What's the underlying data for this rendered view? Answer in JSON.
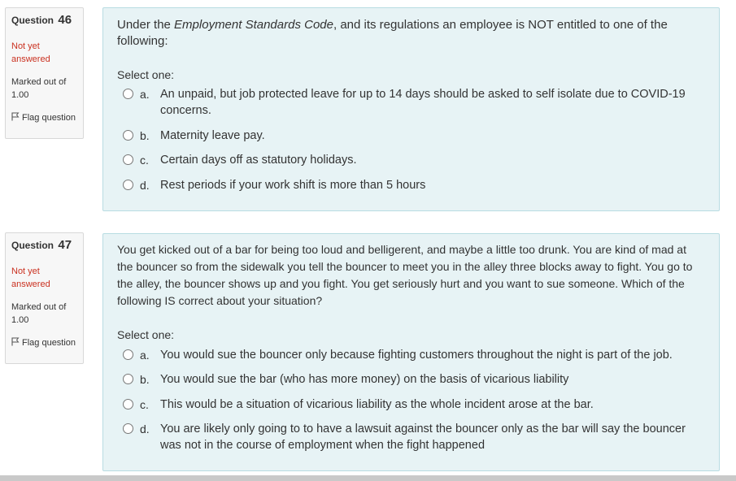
{
  "questions": [
    {
      "label": "Question",
      "number": "46",
      "state": "Not yet answered",
      "marked": "Marked out of 1.00",
      "flag": "Flag question",
      "text_before": "Under the ",
      "text_em": "Employment Standards Code",
      "text_after": ", and its regulations an employee is NOT entitled to one of the following:",
      "select_prompt": "Select one:",
      "options": [
        {
          "letter": "a.",
          "text": "An unpaid, but job protected leave for up to 14 days should be asked to self isolate due to COVID-19 concerns."
        },
        {
          "letter": "b.",
          "text": "Maternity leave pay."
        },
        {
          "letter": "c.",
          "text": "Certain days off as statutory holidays."
        },
        {
          "letter": "d.",
          "text": "Rest periods if your work shift is more than 5 hours"
        }
      ]
    },
    {
      "label": "Question",
      "number": "47",
      "state": "Not yet answered",
      "marked": "Marked out of 1.00",
      "flag": "Flag question",
      "text": "You get kicked out of a bar for being too loud and belligerent, and maybe a little too drunk.  You are kind of mad at the bouncer so from the sidewalk you tell the bouncer to meet you in the alley three blocks away to fight.  You go to the alley, the bouncer shows up and you fight.  You get seriously hurt and you want to sue someone. Which of the following IS correct about your situation?",
      "select_prompt": "Select one:",
      "options": [
        {
          "letter": "a.",
          "text": "You would sue the bouncer only because fighting customers throughout the night is part of the job."
        },
        {
          "letter": "b.",
          "text": "You would sue the bar (who has more money) on the basis of vicarious liability"
        },
        {
          "letter": "c.",
          "text": "This would be a situation of vicarious liability as the whole incident arose at the bar."
        },
        {
          "letter": "d.",
          "text": "You are likely only going to to have a lawsuit against the bouncer only as the bar will say the bouncer was not in the course of employment when the fight happened"
        }
      ]
    }
  ],
  "colors": {
    "state_red": "#ca3120",
    "content_bg": "#e7f3f5",
    "content_border": "#b8dce2",
    "info_bg": "#f7f7f7"
  },
  "icons": {
    "flag": "flag-icon",
    "radio": "radio-button"
  }
}
